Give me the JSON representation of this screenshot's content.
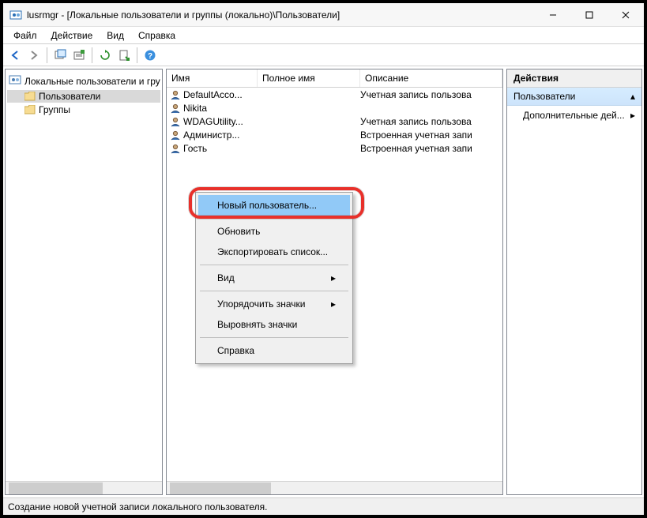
{
  "title": "lusrmgr - [Локальные пользователи и группы (локально)\\Пользователи]",
  "menu": {
    "file": "Файл",
    "action": "Действие",
    "view": "Вид",
    "help": "Справка"
  },
  "tree": {
    "root": "Локальные пользователи и гру",
    "c0": "Пользователи",
    "c1": "Группы"
  },
  "columns": {
    "name": "Имя",
    "fullname": "Полное имя",
    "desc": "Описание"
  },
  "users": [
    {
      "name": "DefaultAcco...",
      "full": "",
      "desc": "Учетная запись пользова"
    },
    {
      "name": "Nikita",
      "full": "",
      "desc": ""
    },
    {
      "name": "WDAGUtility...",
      "full": "",
      "desc": "Учетная запись пользова"
    },
    {
      "name": "Администр...",
      "full": "",
      "desc": "Встроенная учетная запи"
    },
    {
      "name": "Гость",
      "full": "",
      "desc": "Встроенная учетная запи"
    }
  ],
  "actions": {
    "header": "Действия",
    "sub": "Пользователи",
    "more": "Дополнительные дей..."
  },
  "ctx": {
    "new_user": "Новый пользователь...",
    "refresh": "Обновить",
    "export": "Экспортировать список...",
    "view": "Вид",
    "arrange": "Упорядочить значки",
    "align": "Выровнять значки",
    "help": "Справка"
  },
  "status": "Создание новой учетной записи локального пользователя."
}
